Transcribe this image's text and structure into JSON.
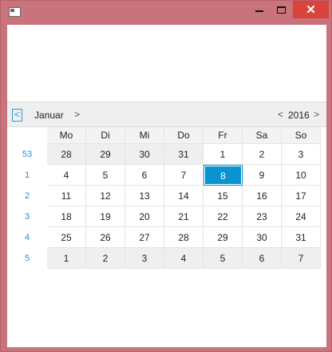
{
  "window": {
    "controls": {
      "minimize": "—",
      "maximize": "□",
      "close": "✕"
    }
  },
  "datepicker": {
    "month": "Januar",
    "year": "2016",
    "prev_symbol": "<",
    "next_symbol": ">",
    "weekdays": [
      "Mo",
      "Di",
      "Mi",
      "Do",
      "Fr",
      "Sa",
      "So"
    ],
    "weeks": [
      {
        "week": "53",
        "days": [
          "28",
          "29",
          "30",
          "31",
          "1",
          "2",
          "3"
        ],
        "other": [
          true,
          true,
          true,
          true,
          false,
          false,
          false
        ]
      },
      {
        "week": "1",
        "days": [
          "4",
          "5",
          "6",
          "7",
          "8",
          "9",
          "10"
        ],
        "other": [
          false,
          false,
          false,
          false,
          false,
          false,
          false
        ]
      },
      {
        "week": "2",
        "days": [
          "11",
          "12",
          "13",
          "14",
          "15",
          "16",
          "17"
        ],
        "other": [
          false,
          false,
          false,
          false,
          false,
          false,
          false
        ]
      },
      {
        "week": "3",
        "days": [
          "18",
          "19",
          "20",
          "21",
          "22",
          "23",
          "24"
        ],
        "other": [
          false,
          false,
          false,
          false,
          false,
          false,
          false
        ]
      },
      {
        "week": "4",
        "days": [
          "25",
          "26",
          "27",
          "28",
          "29",
          "30",
          "31"
        ],
        "other": [
          false,
          false,
          false,
          false,
          false,
          false,
          false
        ]
      },
      {
        "week": "5",
        "days": [
          "1",
          "2",
          "3",
          "4",
          "5",
          "6",
          "7"
        ],
        "other": [
          true,
          true,
          true,
          true,
          true,
          true,
          true
        ]
      }
    ],
    "selected_day": "8",
    "colors": {
      "accent": "#0a93cf",
      "week_number": "#1f8fd0",
      "close_button": "#d9433c"
    }
  }
}
